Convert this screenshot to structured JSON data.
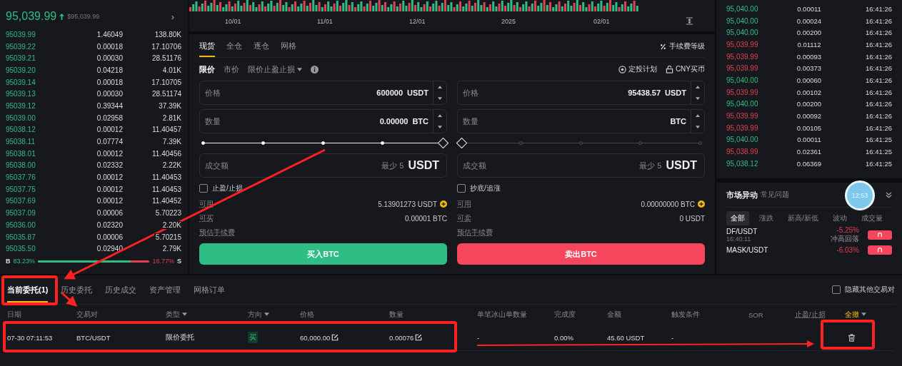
{
  "order_book": {
    "last_price": "95,039.99",
    "usd_price": "$95,039.99",
    "more": "›",
    "rows": [
      {
        "price": "95039.99",
        "amount": "1.46049",
        "total": "138.80K"
      },
      {
        "price": "95039.22",
        "amount": "0.00018",
        "total": "17.10706"
      },
      {
        "price": "95039.21",
        "amount": "0.00030",
        "total": "28.51176"
      },
      {
        "price": "95039.20",
        "amount": "0.04218",
        "total": "4.01K"
      },
      {
        "price": "95039.14",
        "amount": "0.00018",
        "total": "17.10705"
      },
      {
        "price": "95039.13",
        "amount": "0.00030",
        "total": "28.51174"
      },
      {
        "price": "95039.12",
        "amount": "0.39344",
        "total": "37.39K"
      },
      {
        "price": "95039.00",
        "amount": "0.02958",
        "total": "2.81K"
      },
      {
        "price": "95038.12",
        "amount": "0.00012",
        "total": "11.40457"
      },
      {
        "price": "95038.11",
        "amount": "0.07774",
        "total": "7.39K"
      },
      {
        "price": "95038.01",
        "amount": "0.00012",
        "total": "11.40456"
      },
      {
        "price": "95038.00",
        "amount": "0.02332",
        "total": "2.22K"
      },
      {
        "price": "95037.76",
        "amount": "0.00012",
        "total": "11.40453"
      },
      {
        "price": "95037.75",
        "amount": "0.00012",
        "total": "11.40453"
      },
      {
        "price": "95037.69",
        "amount": "0.00012",
        "total": "11.40452"
      },
      {
        "price": "95037.09",
        "amount": "0.00006",
        "total": "5.70223"
      },
      {
        "price": "95036.00",
        "amount": "0.02320",
        "total": "2.20K"
      },
      {
        "price": "95035.87",
        "amount": "0.00006",
        "total": "5.70215"
      },
      {
        "price": "95035.50",
        "amount": "0.02940",
        "total": "2.79K"
      }
    ],
    "buy_label": "B",
    "buy_ratio": "83.23%",
    "sell_ratio": "16.77%",
    "sell_label": "S",
    "level": 0.83
  },
  "chart": {
    "x_labels": [
      "10/01",
      "11/01",
      "12/01",
      "2025",
      "02/01"
    ]
  },
  "trade_form": {
    "tabs": [
      {
        "label": "现货",
        "selected": true
      },
      {
        "label": "全仓",
        "selected": false
      },
      {
        "label": "逐仓",
        "selected": false
      },
      {
        "label": "网格",
        "selected": false
      }
    ],
    "fee_link": "手续费等级",
    "order_types": [
      {
        "label": "限价",
        "selected": true,
        "dropdown": false
      },
      {
        "label": "市价",
        "selected": false,
        "dropdown": false
      },
      {
        "label": "限价止盈止损",
        "selected": false,
        "dropdown": true
      }
    ],
    "links": [
      "定投计划",
      "CNY买币"
    ],
    "panels": [
      {
        "kind": "buy",
        "price_label": "价格",
        "price": "600000",
        "price_unit": "USDT",
        "qty_label": "数量",
        "qty": "0.00000",
        "qty_unit": "BTC",
        "level": 1,
        "total_label": "成交额",
        "total_hint": "最少 5",
        "total_unit": "USDT",
        "option": "止盈/止损",
        "checked": false,
        "available_label": "可用",
        "available": "5.13901273 USDT",
        "max_label": "可买",
        "max": "0.00001 BTC",
        "fee_label": "预估手续费",
        "button": "买入BTC"
      },
      {
        "kind": "sell",
        "price_label": "价格",
        "price": "95438.57",
        "price_unit": "USDT",
        "qty_label": "数量",
        "qty_unit": "BTC",
        "level": 0,
        "total_label": "成交额",
        "total_hint": "最少 5",
        "total_unit": "USDT",
        "option": "抄底/追涨",
        "checked": false,
        "available_label": "可用",
        "available": "0.00000000 BTC",
        "max_label": "可卖",
        "max": "0 USDT",
        "fee_label": "预估手续费",
        "button": "卖出BTC"
      }
    ]
  },
  "trades": [
    {
      "price": "95,040.00",
      "amount": "0.00011",
      "time": "16:41:26",
      "color": "#2ebd85"
    },
    {
      "price": "95,040.00",
      "amount": "0.00024",
      "time": "16:41:26",
      "color": "#2ebd85"
    },
    {
      "price": "95,040.00",
      "amount": "0.00200",
      "time": "16:41:26",
      "color": "#2ebd85"
    },
    {
      "price": "95,039.99",
      "amount": "0.01112",
      "time": "16:41:26",
      "color": "#e0404f"
    },
    {
      "price": "95,039.99",
      "amount": "0.00093",
      "time": "16:41:26",
      "color": "#e0404f"
    },
    {
      "price": "95,039.99",
      "amount": "0.00373",
      "time": "16:41:26",
      "color": "#e0404f"
    },
    {
      "price": "95,040.00",
      "amount": "0.00060",
      "time": "16:41:26",
      "color": "#2ebd85"
    },
    {
      "price": "95,039.99",
      "amount": "0.00102",
      "time": "16:41:26",
      "color": "#e0404f"
    },
    {
      "price": "95,040.00",
      "amount": "0.00200",
      "time": "16:41:26",
      "color": "#2ebd85"
    },
    {
      "price": "95,039.99",
      "amount": "0.00092",
      "time": "16:41:26",
      "color": "#e0404f"
    },
    {
      "price": "95,039.99",
      "amount": "0.00105",
      "time": "16:41:26",
      "color": "#e0404f"
    },
    {
      "price": "95,040.00",
      "amount": "0.00011",
      "time": "16:41:25",
      "color": "#2ebd85"
    },
    {
      "price": "95,038.99",
      "amount": "0.02361",
      "time": "16:41:25",
      "color": "#e0404f"
    },
    {
      "price": "95,038.12",
      "amount": "0.06369",
      "time": "16:41:25",
      "color": "#2ebd85"
    }
  ],
  "market_movers": {
    "title": "市场异动",
    "help": "常见问题",
    "timer": "12:53",
    "tabs": [
      {
        "label": "全部",
        "selected": true
      },
      {
        "label": "涨跌",
        "selected": false
      },
      {
        "label": "新高/新低",
        "selected": false
      },
      {
        "label": "波动",
        "selected": false
      },
      {
        "label": "成交量",
        "selected": false
      }
    ],
    "items": [
      {
        "pair": "DF/USDT",
        "time": "16:40:11",
        "change": "-5.25%",
        "note": "冲高回落"
      },
      {
        "pair": "MASK/USDT",
        "change": "-6.03%"
      }
    ]
  },
  "orders": {
    "tabs": [
      {
        "label": "当前委托(1)",
        "selected": true
      },
      {
        "label": "历史委托",
        "selected": false
      },
      {
        "label": "历史成交",
        "selected": false
      },
      {
        "label": "资产管理",
        "selected": false
      },
      {
        "label": "网格订单",
        "selected": false
      }
    ],
    "hide_others": {
      "label": "隐藏其他交易对",
      "checked": false
    },
    "columns": [
      {
        "label": "日期",
        "dropdown": false,
        "kind": "text"
      },
      {
        "label": "交易对",
        "dropdown": false,
        "kind": "text"
      },
      {
        "label": "类型",
        "dropdown": true,
        "kind": "text"
      },
      {
        "label": "方向",
        "dropdown": true,
        "kind": "text"
      },
      {
        "label": "价格",
        "dropdown": false,
        "kind": "text"
      },
      {
        "label": "数量",
        "dropdown": false,
        "kind": "text"
      },
      {
        "label": "单笔冰山单数量",
        "dropdown": false,
        "kind": "text"
      },
      {
        "label": "完成度",
        "dropdown": false,
        "kind": "text"
      },
      {
        "label": "金额",
        "dropdown": false,
        "kind": "text"
      },
      {
        "label": "触发条件",
        "dropdown": false,
        "kind": "text"
      },
      {
        "label": "SOR",
        "dropdown": false,
        "kind": "text"
      },
      {
        "label": "止盈/止损",
        "dropdown": false,
        "kind": "link"
      },
      {
        "label": "全撤",
        "dropdown": true,
        "kind": "action"
      }
    ],
    "rows": [
      [
        {
          "kind": "text",
          "text": "07-30 07:11:53"
        },
        {
          "kind": "text",
          "text": "BTC/USDT"
        },
        {
          "kind": "text",
          "text": "限价委托"
        },
        {
          "kind": "side",
          "text": "买"
        },
        {
          "kind": "edit",
          "text": "60,000.00"
        },
        {
          "kind": "edit",
          "text": "0.00076"
        },
        {
          "kind": "text",
          "text": "-"
        },
        {
          "kind": "text",
          "text": "0.00%"
        },
        {
          "kind": "text",
          "text": "45.60 USDT"
        },
        {
          "kind": "text",
          "text": "-"
        },
        {
          "kind": "empty"
        },
        {
          "kind": "empty"
        },
        {
          "kind": "delete"
        }
      ]
    ]
  }
}
